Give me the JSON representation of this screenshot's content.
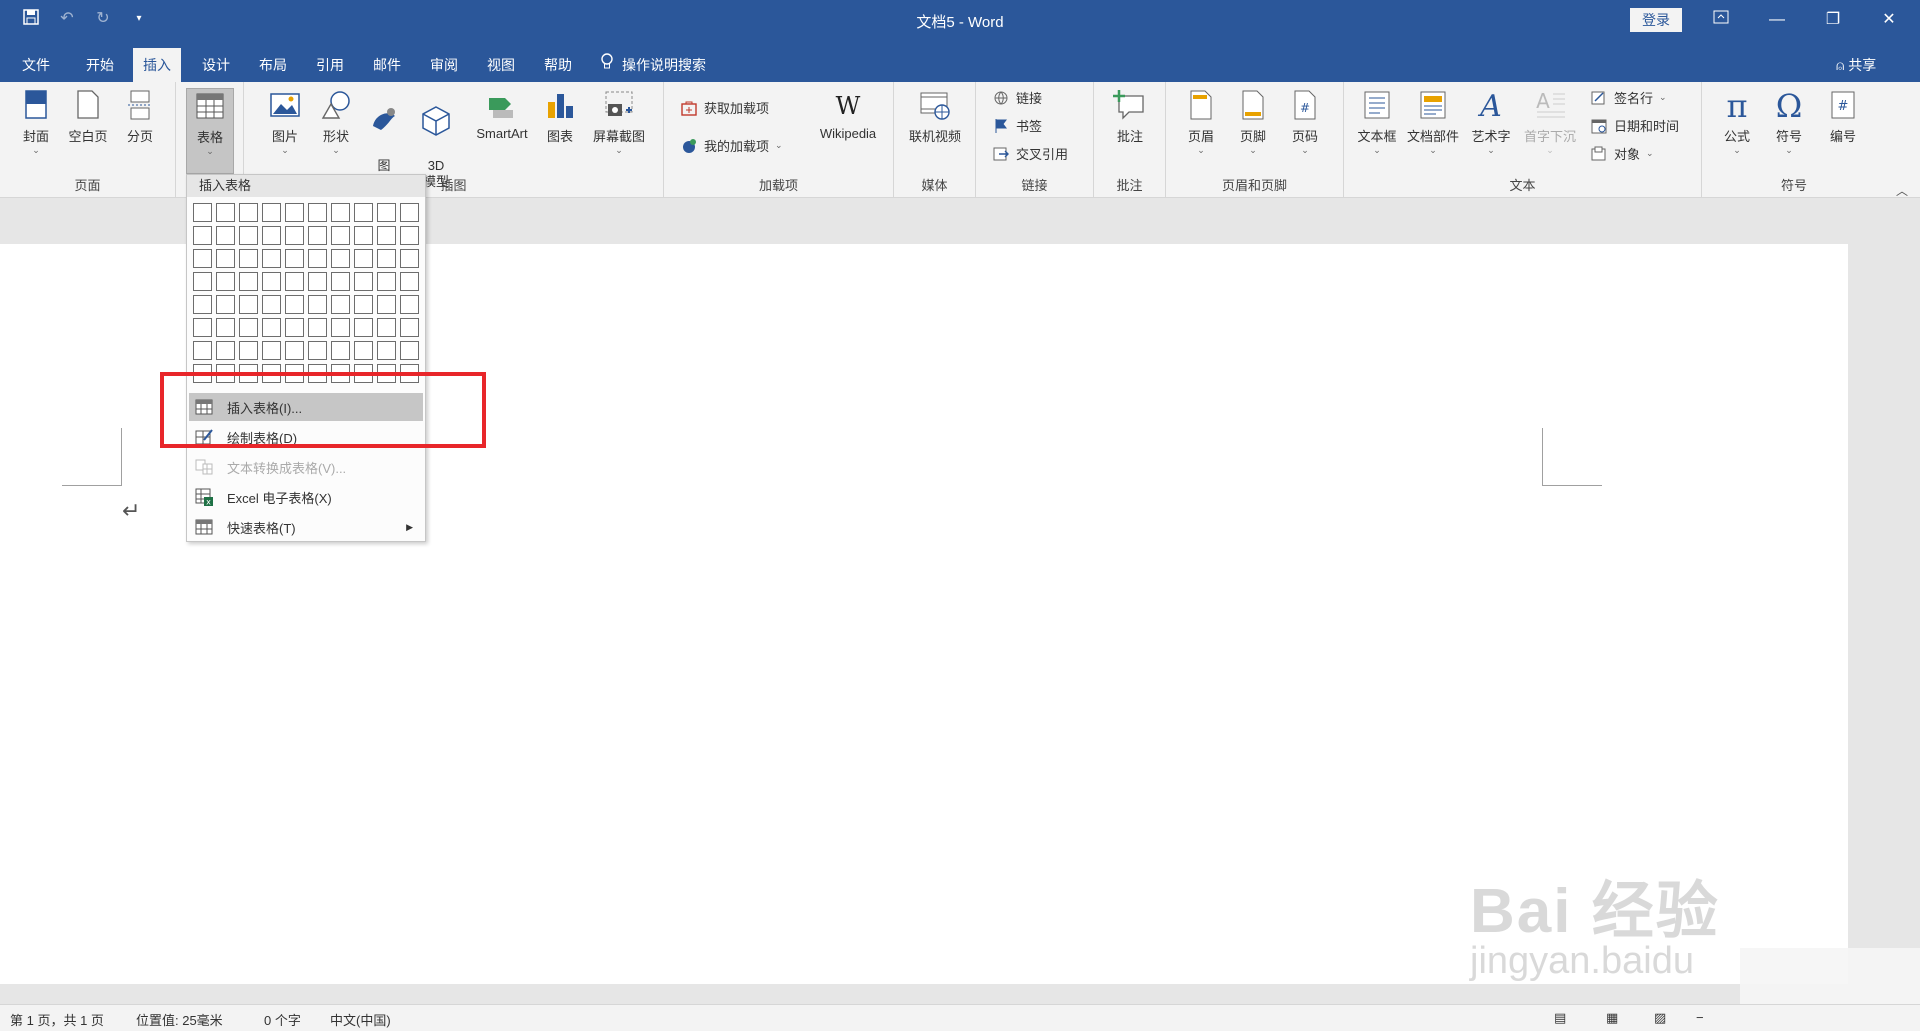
{
  "title_bar": {
    "doc_title": "文档5  -  Word",
    "login": "登录"
  },
  "tabs": [
    {
      "label": "文件"
    },
    {
      "label": "开始"
    },
    {
      "label": "插入"
    },
    {
      "label": "设计"
    },
    {
      "label": "布局"
    },
    {
      "label": "引用"
    },
    {
      "label": "邮件"
    },
    {
      "label": "审阅"
    },
    {
      "label": "视图"
    },
    {
      "label": "帮助"
    }
  ],
  "tell_me": "操作说明搜索",
  "share": "共享",
  "ribbon": {
    "pages": {
      "label": "页面",
      "cover": "封面",
      "blank_page": "空白页",
      "page_break": "分页"
    },
    "tables": {
      "table": "表格"
    },
    "illustrations": {
      "label": "插图",
      "picture": "图片",
      "shapes": "形状",
      "icons": "图\n标",
      "model3d": "3D\n模型",
      "smartart": "SmartArt",
      "chart": "图表",
      "screenshot": "屏幕截图"
    },
    "addins": {
      "label": "加载项",
      "get_addins": "获取加载项",
      "my_addins": "我的加载项",
      "wikipedia": "Wikipedia"
    },
    "media": {
      "label": "媒体",
      "online_video": "联机视频"
    },
    "links": {
      "label": "链接",
      "link": "链接",
      "bookmark": "书签",
      "cross_ref": "交叉引用"
    },
    "comments": {
      "label": "批注",
      "comment": "批注"
    },
    "header_footer": {
      "label": "页眉和页脚",
      "header": "页眉",
      "footer": "页脚",
      "page_number": "页码"
    },
    "text": {
      "label": "文本",
      "textbox": "文本框",
      "quick_parts": "文档部件",
      "wordart": "艺术字",
      "dropcap": "首字下沉",
      "signature": "签名行",
      "datetime": "日期和时间",
      "object": "对象"
    },
    "symbols": {
      "label": "符号",
      "equation": "公式",
      "symbol": "符号",
      "numbering": "编号"
    }
  },
  "table_dropdown": {
    "header": "插入表格",
    "grid_rows": 8,
    "grid_cols": 10,
    "items": [
      {
        "label": "插入表格(I)...",
        "icon": "table-icon",
        "disabled": false,
        "hover": true
      },
      {
        "label": "绘制表格(D)",
        "icon": "draw-table-icon",
        "disabled": false,
        "hover": false
      },
      {
        "label": "文本转换成表格(V)...",
        "icon": "convert-text-icon",
        "disabled": true,
        "hover": false
      },
      {
        "label": "Excel 电子表格(X)",
        "icon": "excel-icon",
        "disabled": false,
        "hover": false
      },
      {
        "label": "快速表格(T)",
        "icon": "quick-table-icon",
        "disabled": false,
        "hover": false,
        "submenu": true
      }
    ]
  },
  "watermark": {
    "main": "Bai 经验",
    "sub": "jingyan.baidu"
  },
  "status_bar": {
    "page": "第 1 页，共 1 页",
    "position": "位置值: 25毫米",
    "words": "0 个字",
    "language": "中文(中国)"
  },
  "colors": {
    "accent": "#2b579a",
    "highlight": "#e8262a"
  }
}
